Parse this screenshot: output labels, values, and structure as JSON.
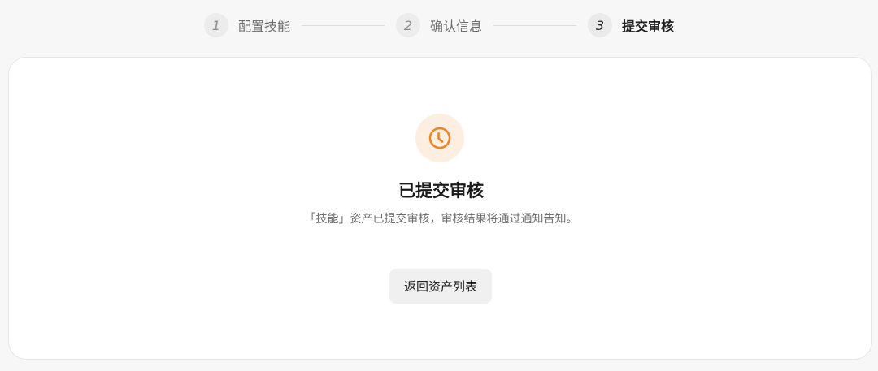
{
  "stepper": {
    "steps": [
      {
        "number": "1",
        "label": "配置技能"
      },
      {
        "number": "2",
        "label": "确认信息"
      },
      {
        "number": "3",
        "label": "提交审核"
      }
    ]
  },
  "result": {
    "icon": "clock-icon",
    "icon_color": "#f08423",
    "icon_bg": "#fdeee2",
    "title": "已提交审核",
    "description": "「技能」资产已提交审核，审核结果将通过通知告知。"
  },
  "actions": {
    "back_label": "返回资产列表"
  }
}
